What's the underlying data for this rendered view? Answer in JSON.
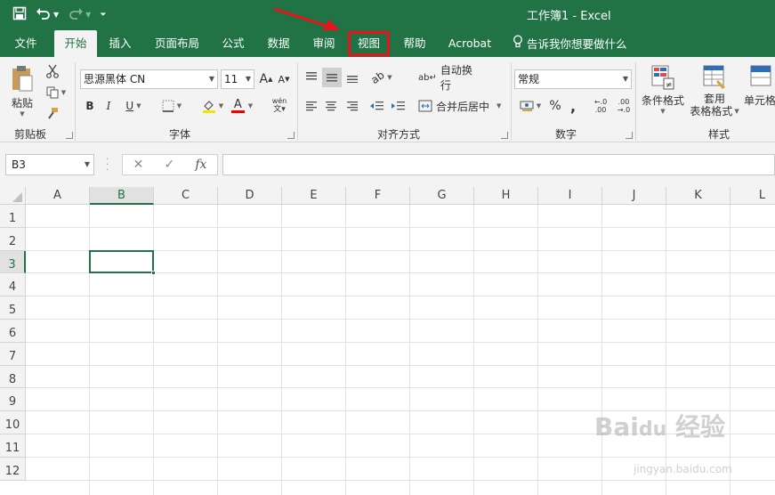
{
  "window": {
    "title": "工作簿1  -  Excel"
  },
  "quick_access": {
    "save_icon": "save-icon",
    "undo_icon": "undo-icon",
    "redo_icon": "redo-icon",
    "customize_icon": "chevron-down-icon"
  },
  "tabs": [
    {
      "label": "文件",
      "active": false
    },
    {
      "label": "开始",
      "active": true
    },
    {
      "label": "插入",
      "active": false
    },
    {
      "label": "页面布局",
      "active": false
    },
    {
      "label": "公式",
      "active": false
    },
    {
      "label": "数据",
      "active": false
    },
    {
      "label": "审阅",
      "active": false
    },
    {
      "label": "视图",
      "active": false,
      "highlighted": true
    },
    {
      "label": "帮助",
      "active": false
    },
    {
      "label": "Acrobat",
      "active": false
    }
  ],
  "tell_me": {
    "label": "告诉我你想要做什么"
  },
  "ribbon": {
    "clipboard": {
      "paste_label": "粘贴",
      "group_label": "剪贴板"
    },
    "font": {
      "font_name": "思源黑体 CN",
      "font_size": "11",
      "grow": "A",
      "shrink": "A",
      "bold": "B",
      "italic": "I",
      "underline": "U",
      "font_color_letter": "A",
      "wen": "wén",
      "group_label": "字体"
    },
    "alignment": {
      "wrap_text": "自动换行",
      "merge_center": "合并后居中",
      "group_label": "对齐方式"
    },
    "number": {
      "format": "常规",
      "percent": "%",
      "comma": ",",
      "inc_decimal": "←.0\n.00",
      "dec_decimal": ".00\n→.0",
      "group_label": "数字"
    },
    "styles": {
      "conditional_format": "条件格式",
      "table_format_1": "套用",
      "table_format_2": "表格格式",
      "cell_styles": "单元格",
      "group_label": "样式"
    }
  },
  "formula_bar": {
    "name_box": "B3",
    "cancel": "✕",
    "enter": "✓",
    "fx": "fx",
    "value": ""
  },
  "sheet": {
    "columns": [
      "A",
      "B",
      "C",
      "D",
      "E",
      "F",
      "G",
      "H",
      "I",
      "J",
      "K",
      "L"
    ],
    "rows": [
      "1",
      "2",
      "3",
      "4",
      "5",
      "6",
      "7",
      "8",
      "9",
      "10",
      "11",
      "12"
    ],
    "selected_cell": "B3",
    "selected_column": "B",
    "selected_row": "3"
  },
  "colors": {
    "excel_green": "#217346",
    "highlight_red": "#e8141b"
  }
}
